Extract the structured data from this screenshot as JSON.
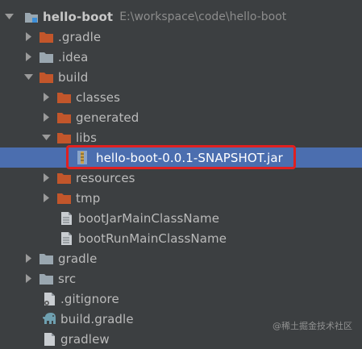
{
  "project": {
    "name": "hello-boot",
    "path": "E:\\workspace\\code\\hello-boot"
  },
  "tree": [
    {
      "label": "hello-boot",
      "type": "root",
      "expanded": true
    },
    {
      "label": ".gradle",
      "type": "folder-orange",
      "expanded": false
    },
    {
      "label": ".idea",
      "type": "folder-gray",
      "expanded": false
    },
    {
      "label": "build",
      "type": "folder-orange",
      "expanded": true
    },
    {
      "label": "classes",
      "type": "folder-orange",
      "expanded": false
    },
    {
      "label": "generated",
      "type": "folder-orange",
      "expanded": false
    },
    {
      "label": "libs",
      "type": "folder-orange",
      "expanded": true
    },
    {
      "label": "hello-boot-0.0.1-SNAPSHOT.jar",
      "type": "jar",
      "selected": true
    },
    {
      "label": "resources",
      "type": "folder-orange",
      "expanded": false
    },
    {
      "label": "tmp",
      "type": "folder-orange",
      "expanded": false
    },
    {
      "label": "bootJarMainClassName",
      "type": "file"
    },
    {
      "label": "bootRunMainClassName",
      "type": "file"
    },
    {
      "label": "gradle",
      "type": "folder-gray",
      "expanded": false
    },
    {
      "label": "src",
      "type": "folder-gray",
      "expanded": false
    },
    {
      "label": ".gitignore",
      "type": "file-git"
    },
    {
      "label": "build.gradle",
      "type": "gradle"
    },
    {
      "label": "gradlew",
      "type": "file"
    }
  ],
  "watermark": "@稀土掘金技术社区",
  "colors": {
    "background": "#3c3f41",
    "selection": "#4b6eaf",
    "folder_orange": "#c2562b",
    "folder_gray": "#9aa7b0",
    "highlight_box": "#e02020"
  }
}
